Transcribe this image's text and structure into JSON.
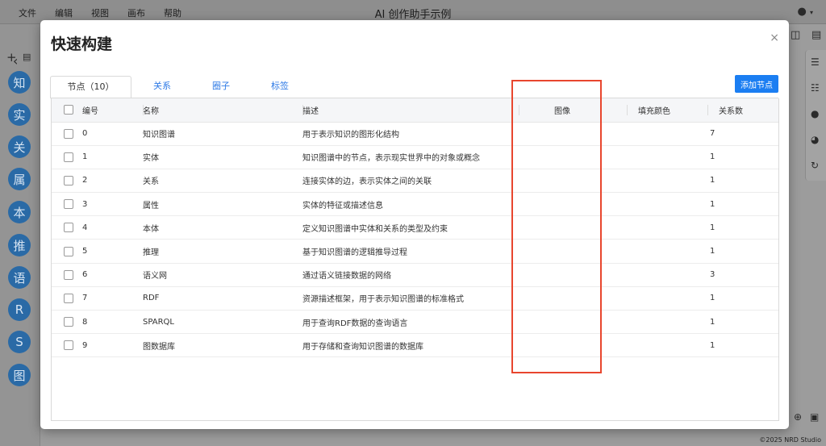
{
  "menubar": {
    "items": [
      "文件",
      "编辑",
      "视图",
      "画布",
      "帮助"
    ],
    "app_title": "AI 创作助手示例",
    "user_icon": "user-icon"
  },
  "sidebar": {
    "circles": [
      "知",
      "实",
      "关",
      "属",
      "本",
      "推",
      "语",
      "R",
      "S",
      "图"
    ]
  },
  "footer": {
    "copyright": "©2025 NRD Studio"
  },
  "modal": {
    "title": "快速构建",
    "close_label": "×",
    "tabs": [
      {
        "label": "节点（10）",
        "active": true
      },
      {
        "label": "关系",
        "active": false
      },
      {
        "label": "圈子",
        "active": false
      },
      {
        "label": "标签",
        "active": false
      }
    ],
    "add_button": "添加节点",
    "columns": [
      "编号",
      "名称",
      "描述",
      "图像",
      "填充颜色",
      "关系数"
    ],
    "rows": [
      {
        "id": "0",
        "name": "知识图谱",
        "desc": "用于表示知识的图形化结构",
        "image": "",
        "fill": "",
        "relations": "7"
      },
      {
        "id": "1",
        "name": "实体",
        "desc": "知识图谱中的节点，表示现实世界中的对象或概念",
        "image": "",
        "fill": "",
        "relations": "1"
      },
      {
        "id": "2",
        "name": "关系",
        "desc": "连接实体的边，表示实体之间的关联",
        "image": "",
        "fill": "",
        "relations": "1"
      },
      {
        "id": "3",
        "name": "属性",
        "desc": "实体的特征或描述信息",
        "image": "",
        "fill": "",
        "relations": "1"
      },
      {
        "id": "4",
        "name": "本体",
        "desc": "定义知识图谱中实体和关系的类型及约束",
        "image": "",
        "fill": "",
        "relations": "1"
      },
      {
        "id": "5",
        "name": "推理",
        "desc": "基于知识图谱的逻辑推导过程",
        "image": "",
        "fill": "",
        "relations": "1"
      },
      {
        "id": "6",
        "name": "语义网",
        "desc": "通过语义链接数据的网络",
        "image": "",
        "fill": "",
        "relations": "3"
      },
      {
        "id": "7",
        "name": "RDF",
        "desc": "资源描述框架，用于表示知识图谱的标准格式",
        "image": "",
        "fill": "",
        "relations": "1"
      },
      {
        "id": "8",
        "name": "SPARQL",
        "desc": "用于查询RDF数据的查询语言",
        "image": "",
        "fill": "",
        "relations": "1"
      },
      {
        "id": "9",
        "name": "图数据库",
        "desc": "用于存储和查询知识图谱的数据库",
        "image": "",
        "fill": "",
        "relations": "1"
      }
    ]
  },
  "colors": {
    "accent": "#1b7ef2",
    "highlight": "#e8462e",
    "sidebar_circle": "#2a6aa6"
  }
}
